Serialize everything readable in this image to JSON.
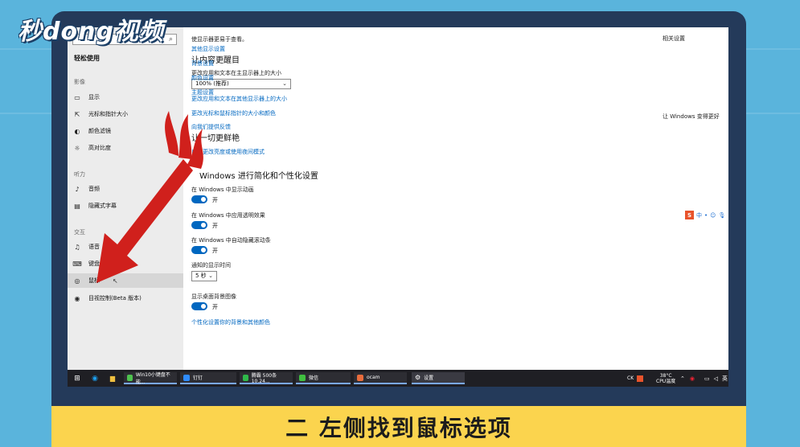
{
  "brand": {
    "logo_text": "秒dong视频"
  },
  "caption": {
    "text": "二 左侧找到鼠标选项"
  },
  "sidebar": {
    "title": "轻松使用",
    "groups": [
      "影像",
      "听力",
      "交互"
    ],
    "items": [
      {
        "icon": "display-icon",
        "glyph": "▭",
        "label": "显示"
      },
      {
        "icon": "cursor-icon",
        "glyph": "⇱",
        "label": "光标和指针大小"
      },
      {
        "icon": "color-filter-icon",
        "glyph": "◐",
        "label": "颜色滤镜"
      },
      {
        "icon": "high-contrast-icon",
        "glyph": "☼",
        "label": "高对比度"
      },
      {
        "icon": "audio-icon",
        "glyph": "♪",
        "label": "音频"
      },
      {
        "icon": "caption-icon",
        "glyph": "▤",
        "label": "隐藏式字幕"
      },
      {
        "icon": "speech-icon",
        "glyph": "♫",
        "label": "语音"
      },
      {
        "icon": "keyboard-icon",
        "glyph": "⌨",
        "label": "键盘"
      },
      {
        "icon": "mouse-icon",
        "glyph": "◎",
        "label": "鼠标"
      },
      {
        "icon": "eye-control-icon",
        "glyph": "◉",
        "label": "目视控制(Beta 版本)"
      }
    ]
  },
  "main": {
    "top_note": "使显示器更易于查看。",
    "section1_title": "让内容更醒目",
    "scale_label": "更改应用和文本在主显示器上的大小",
    "scale_value": "100% (推荐)",
    "link_other_display": "更改应用和文本在其他显示器上的大小",
    "link_pointer": "更改光标和鼠标指针的大小和颜色",
    "section2_title": "让一切更鲜艳",
    "link_auto_brightness": "自动更改亮度或使用夜间模式",
    "section3_title": "Windows 进行简化和个性化设置",
    "toggle1_label": "在 Windows 中显示动画",
    "toggle2_label": "在 Windows 中应用透明效果",
    "toggle3_label": "在 Windows 中自动隐藏滚动条",
    "toggle_state": "开",
    "notify_label": "通知的显示时间",
    "notify_value": "5 秒",
    "bg_label": "显示桌面背景图像",
    "link_personalize": "个性化设置你的背景和其他颜色"
  },
  "related": {
    "head": "相关设置",
    "links": [
      "其他显示设置",
      "背景设置",
      "颜色设置",
      "主题设置"
    ],
    "feedback_head": "让 Windows 变得更好",
    "feedback_link": "向我们提供反馈"
  },
  "ime": {
    "logo": "S",
    "items": [
      "中",
      "•",
      "☺",
      "🎙"
    ]
  },
  "taskbar": {
    "tasks": [
      {
        "label": "Win10小键盘不能...",
        "color": "#4ec24e"
      },
      {
        "label": "钉钉",
        "color": "#2f8cff"
      },
      {
        "label": "腾霸 500条 10.24...",
        "color": "#2fb84a"
      },
      {
        "label": "微信",
        "color": "#40c040"
      },
      {
        "label": "ocam",
        "color": "#e86c3c"
      },
      {
        "label": "设置",
        "color": "#9a9a9a"
      }
    ],
    "tray_ck": "CK",
    "temp": "38°C",
    "temp_label": "CPU温度"
  },
  "colors": {
    "accent": "#0067c0",
    "arrow": "#d0201c",
    "caption_bg": "#fbd44e"
  }
}
